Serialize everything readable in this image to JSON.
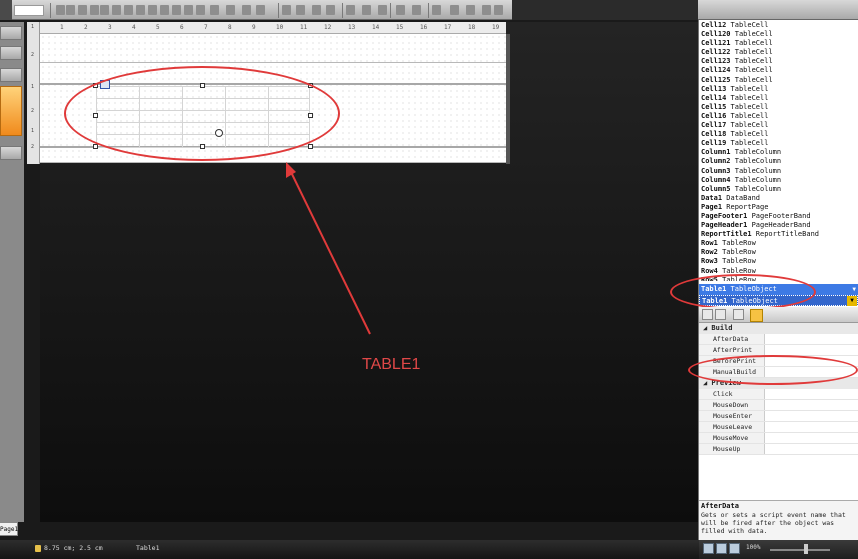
{
  "canvas": {
    "vruler_ticks": [
      "1",
      "2",
      "1",
      "2",
      "1",
      "2"
    ],
    "hruler_ticks": [
      "1",
      "2",
      "3",
      "4",
      "5",
      "6",
      "7",
      "8",
      "9",
      "10",
      "11",
      "12",
      "13",
      "14",
      "15",
      "16",
      "17",
      "18",
      "19"
    ]
  },
  "annotation": {
    "label": "TABLE1"
  },
  "object_list": {
    "items": [
      {
        "name": "Cell12",
        "type": "TableCell"
      },
      {
        "name": "Cell120",
        "type": "TableCell"
      },
      {
        "name": "Cell121",
        "type": "TableCell"
      },
      {
        "name": "Cell122",
        "type": "TableCell"
      },
      {
        "name": "Cell123",
        "type": "TableCell"
      },
      {
        "name": "Cell124",
        "type": "TableCell"
      },
      {
        "name": "Cell125",
        "type": "TableCell"
      },
      {
        "name": "Cell13",
        "type": "TableCell"
      },
      {
        "name": "Cell14",
        "type": "TableCell"
      },
      {
        "name": "Cell15",
        "type": "TableCell"
      },
      {
        "name": "Cell16",
        "type": "TableCell"
      },
      {
        "name": "Cell17",
        "type": "TableCell"
      },
      {
        "name": "Cell18",
        "type": "TableCell"
      },
      {
        "name": "Cell19",
        "type": "TableCell"
      },
      {
        "name": "Column1",
        "type": "TableColumn"
      },
      {
        "name": "Column2",
        "type": "TableColumn"
      },
      {
        "name": "Column3",
        "type": "TableColumn"
      },
      {
        "name": "Column4",
        "type": "TableColumn"
      },
      {
        "name": "Column5",
        "type": "TableColumn"
      },
      {
        "name": "Data1",
        "type": "DataBand"
      },
      {
        "name": "Page1",
        "type": "ReportPage"
      },
      {
        "name": "PageFooter1",
        "type": "PageFooterBand"
      },
      {
        "name": "PageHeader1",
        "type": "PageHeaderBand"
      },
      {
        "name": "ReportTitle1",
        "type": "ReportTitleBand"
      },
      {
        "name": "Row1",
        "type": "TableRow"
      },
      {
        "name": "Row2",
        "type": "TableRow"
      },
      {
        "name": "Row3",
        "type": "TableRow"
      },
      {
        "name": "Row4",
        "type": "TableRow"
      },
      {
        "name": "Row5",
        "type": "TableRow"
      }
    ],
    "selected_item": {
      "name": "Table1",
      "type": "TableObject"
    },
    "combo_value": {
      "name": "Table1",
      "type": "TableObject"
    }
  },
  "properties": {
    "categories": [
      {
        "name": "Build",
        "rows": [
          "AfterData",
          "AfterPrint",
          "BeforePrint",
          "ManualBuild"
        ]
      },
      {
        "name": "Preview",
        "rows": [
          "Click",
          "MouseDown",
          "MouseEnter",
          "MouseLeave",
          "MouseMove",
          "MouseUp"
        ]
      }
    ],
    "description_title": "AfterData",
    "description_text": "Gets or sets a script event name that will be fired after the object was filled with data."
  },
  "status": {
    "page_tab": "Page1",
    "coords": "8.75 cm; 2.5 cm",
    "object_name": "Table1",
    "zoom": "100%"
  },
  "colors": {
    "annotation_red": "#e03a3a",
    "selection_blue": "#3d7ae5",
    "canvas_dark": "#1a1a1a"
  }
}
